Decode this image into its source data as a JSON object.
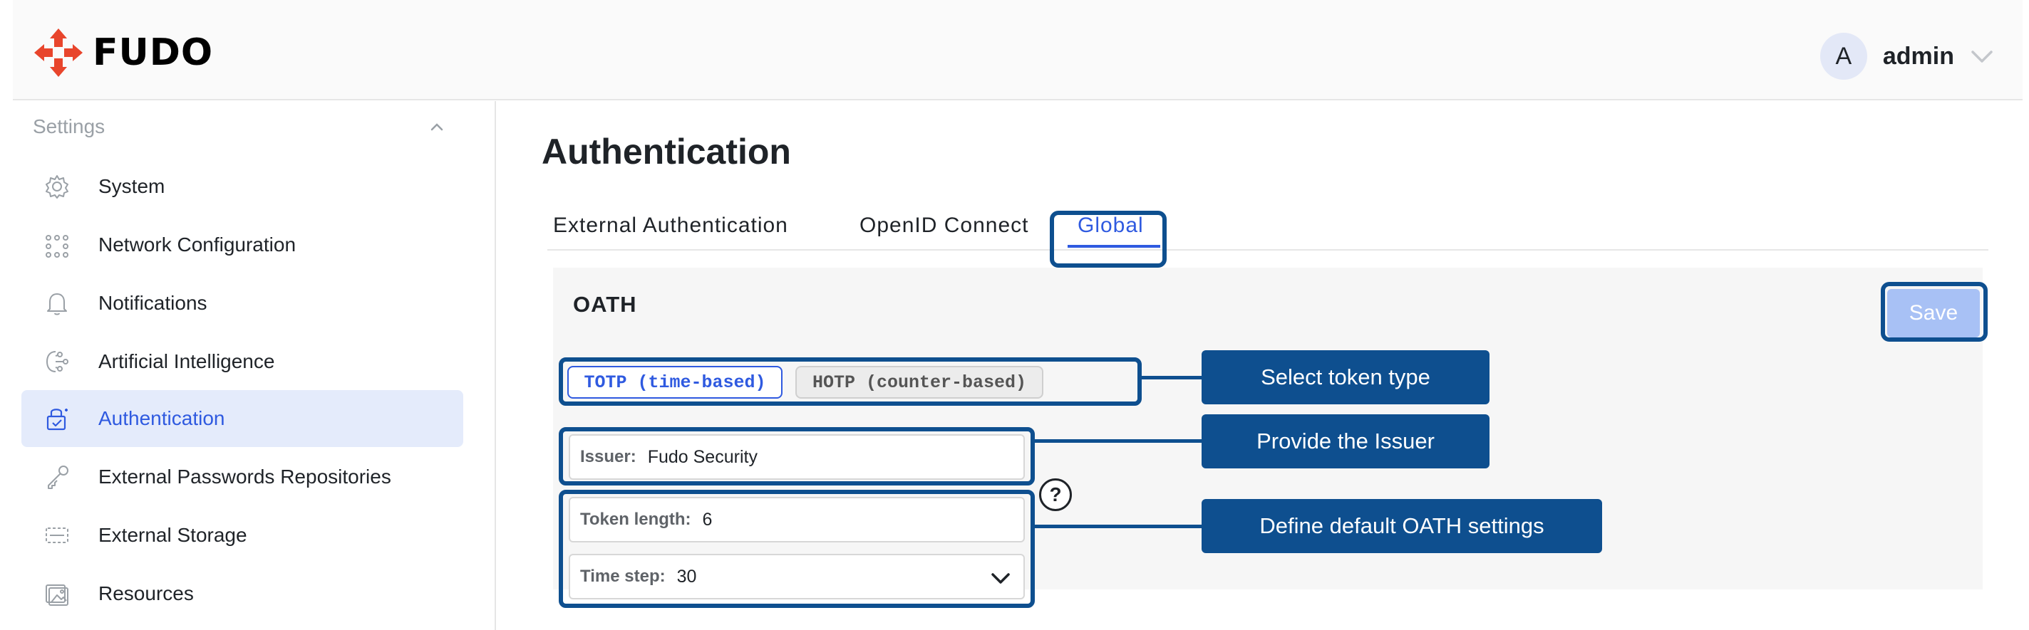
{
  "brand": {
    "name": "FUDO"
  },
  "user": {
    "initial": "A",
    "name": "admin"
  },
  "sidebar": {
    "section_title": "Settings",
    "items": [
      {
        "label": "System",
        "icon": "gear-icon"
      },
      {
        "label": "Network Configuration",
        "icon": "network-icon"
      },
      {
        "label": "Notifications",
        "icon": "bell-icon"
      },
      {
        "label": "Artificial Intelligence",
        "icon": "ai-icon"
      },
      {
        "label": "Authentication",
        "icon": "lock-icon",
        "active": true
      },
      {
        "label": "External Passwords Repositories",
        "icon": "key-icon"
      },
      {
        "label": "External Storage",
        "icon": "storage-icon"
      },
      {
        "label": "Resources",
        "icon": "image-icon"
      }
    ]
  },
  "main": {
    "title": "Authentication",
    "tabs": [
      {
        "label": "External Authentication"
      },
      {
        "label": "OpenID Connect"
      },
      {
        "label": "Global",
        "active": true
      }
    ],
    "panel": {
      "title": "OATH",
      "save_label": "Save",
      "token_types": [
        {
          "label": "TOTP (time-based)",
          "selected": true
        },
        {
          "label": "HOTP (counter-based)",
          "selected": false
        }
      ],
      "issuer": {
        "label": "Issuer:",
        "value": "Fudo Security"
      },
      "token_length": {
        "label": "Token length:",
        "value": "6"
      },
      "time_step": {
        "label": "Time step:",
        "value": "30"
      },
      "help_glyph": "?"
    }
  },
  "callouts": {
    "token_type": "Select token type",
    "issuer": "Provide the Issuer",
    "defaults": "Define default OATH settings"
  },
  "colors": {
    "accent": "#2f5ae0",
    "annotation": "#0e4f8f",
    "active_bg": "#e4ebfb",
    "save_disabled": "#a8c1f5",
    "logo_red": "#e8452c"
  }
}
